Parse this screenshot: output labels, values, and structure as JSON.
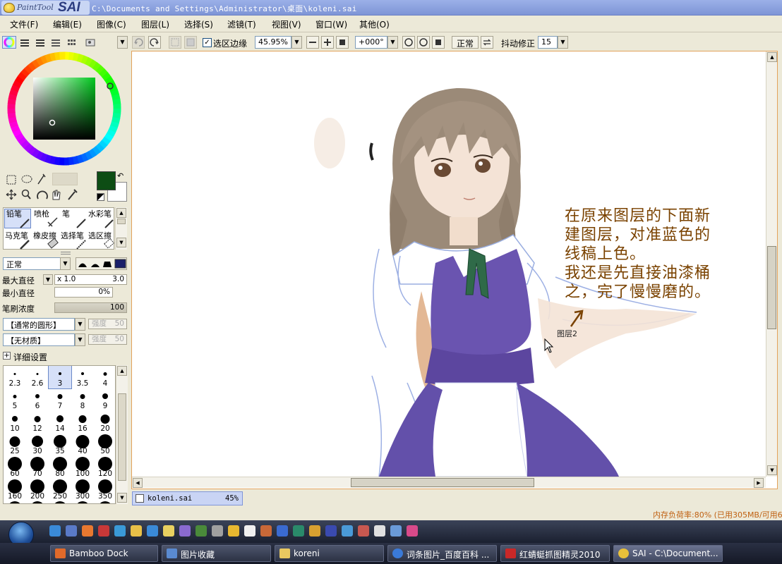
{
  "window": {
    "app_name_small": "PaintTool",
    "app_name_big": "SAI",
    "title": "C:\\Documents and Settings\\Administrator\\桌面\\koleni.sai"
  },
  "menu": [
    "文件(F)",
    "编辑(E)",
    "图像(C)",
    "图层(L)",
    "选择(S)",
    "滤镜(T)",
    "视图(V)",
    "窗口(W)",
    "其他(O)"
  ],
  "toolbar": {
    "selection_edge_label": "选区边缘",
    "selection_edge_checked": true,
    "zoom": "45.95%",
    "rotation": "+000°",
    "normal_btn": "正常",
    "stabilizer_label": "抖动修正",
    "stabilizer_value": "15"
  },
  "brush_tools": [
    "铅笔",
    "喷枪",
    "笔",
    "水彩笔",
    "马克笔",
    "橡皮擦",
    "选择笔",
    "选区擦"
  ],
  "brush_settings": {
    "blend_mode": "正常",
    "max_size_label": "最大直径",
    "max_size_mult": "x 1.0",
    "max_size_value": "3.0",
    "min_size_label": "最小直径",
    "min_size_value": "0%",
    "density_label": "笔刷浓度",
    "density_value": "100",
    "shape": "【通常的圆形】",
    "shape_strength_label": "强度",
    "shape_strength": "50",
    "texture": "【无材质】",
    "texture_strength_label": "强度",
    "texture_strength": "50",
    "advanced_label": "详细设置"
  },
  "brush_sizes": [
    "2.3",
    "2.6",
    "3",
    "3.5",
    "4",
    "5",
    "6",
    "7",
    "8",
    "9",
    "10",
    "12",
    "14",
    "16",
    "20",
    "25",
    "30",
    "35",
    "40",
    "50",
    "60",
    "70",
    "80",
    "100",
    "120",
    "160",
    "200",
    "250",
    "300",
    "350"
  ],
  "selected_brush_size": "3",
  "colors": {
    "primary": "#0d4d14",
    "secondary": "#ffffff",
    "accent_frame": "#e2a25b"
  },
  "canvas": {
    "annotation": "在原来图层的下面新\n建图层，对准蓝色的\n线稿上色。\n我还是先直接油漆桶\n之，完了慢慢磨的。",
    "layer_label": "图层2"
  },
  "document_tab": {
    "name": "koleni.sai",
    "zoom": "45%"
  },
  "status": {
    "memory": "内存负荷率:80% (已用305MB/可用6"
  },
  "taskbar": {
    "tasks": [
      "Bamboo Dock",
      "图片收藏",
      "koreni",
      "词条图片_百度百科 ...",
      "红蜻蜓抓图精灵2010",
      "SAI - C:\\Document..."
    ]
  },
  "icons": [
    "color-wheel-icon",
    "rgb-slider-icon",
    "hsv-slider-icon",
    "palette-icon",
    "scratchpad-icon",
    "undo-icon",
    "redo-icon",
    "deselect-icon",
    "invert-selection-icon",
    "zoom-out-icon",
    "zoom-in-icon",
    "zoom-reset-icon",
    "rotate-ccw-icon",
    "rotate-cw-icon",
    "rotate-reset-icon",
    "flip-icon",
    "marquee-icon",
    "lasso-icon",
    "magic-wand-icon",
    "move-icon",
    "zoom-icon",
    "rotate-icon",
    "hand-icon",
    "eyedropper-icon",
    "swap-colors-icon",
    "start-orb-icon"
  ]
}
